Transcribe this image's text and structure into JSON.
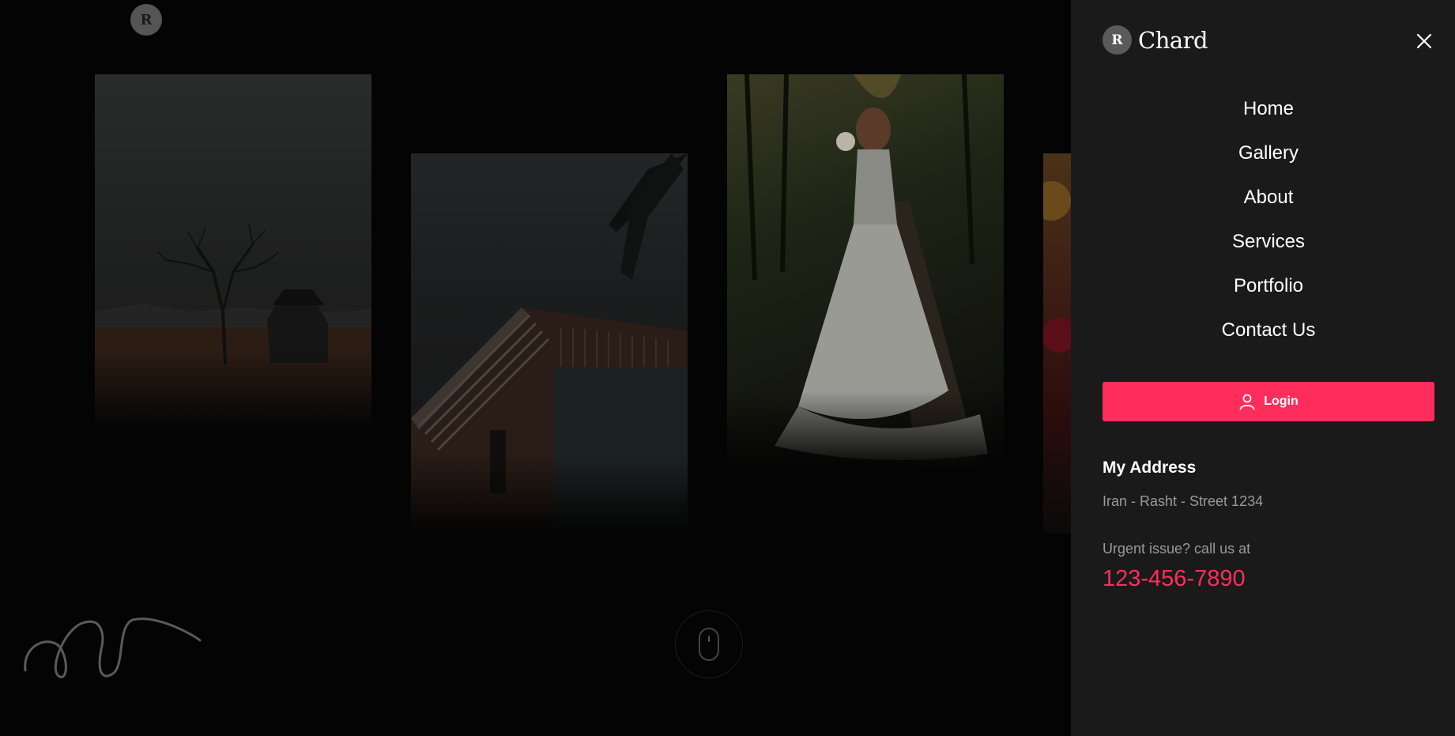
{
  "background": {
    "logo_letter": "R",
    "photos": [
      "tree-landscape-photo",
      "building-palm-photo",
      "bride-forest-photo",
      "flowers-photo"
    ]
  },
  "drawer": {
    "brand": {
      "mark": "R",
      "name": "Chard"
    },
    "nav": [
      {
        "label": "Home"
      },
      {
        "label": "Gallery"
      },
      {
        "label": "About"
      },
      {
        "label": "Services"
      },
      {
        "label": "Portfolio"
      },
      {
        "label": "Contact Us"
      }
    ],
    "login_label": "Login",
    "address_title": "My Address",
    "address_text": "Iran - Rasht - Street 1234",
    "urgent_text": "Urgent issue? call us at",
    "phone": "123-456-7890"
  },
  "colors": {
    "accent": "#ff2d5c",
    "drawer_bg": "#1a1a1a",
    "page_bg": "#040404"
  },
  "icons": {
    "close": "close-icon",
    "user": "user-icon",
    "mouse": "mouse-scroll-icon"
  }
}
